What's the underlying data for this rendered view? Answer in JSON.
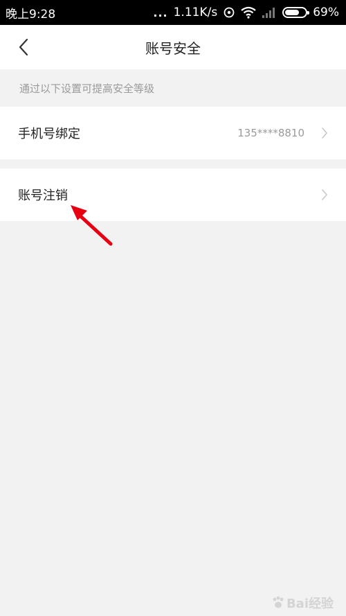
{
  "status_bar": {
    "time": "晚上9:28",
    "dots": "...",
    "speed": "1.11K/s",
    "battery": "69%",
    "battery_level": 0.69
  },
  "nav": {
    "title": "账号安全",
    "back_icon": "chevron-left-icon"
  },
  "hint": "通过以下设置可提高安全等级",
  "rows": [
    {
      "label": "手机号绑定",
      "value": "135****8810"
    },
    {
      "label": "账号注销"
    }
  ],
  "watermark": "Bai经验",
  "colors": {
    "status_bar_bg": "#000000",
    "page_bg": "#f2f2f2",
    "card_bg": "#ffffff",
    "secondary_text": "#9a9a9a",
    "annotation_arrow": "#e60012"
  }
}
